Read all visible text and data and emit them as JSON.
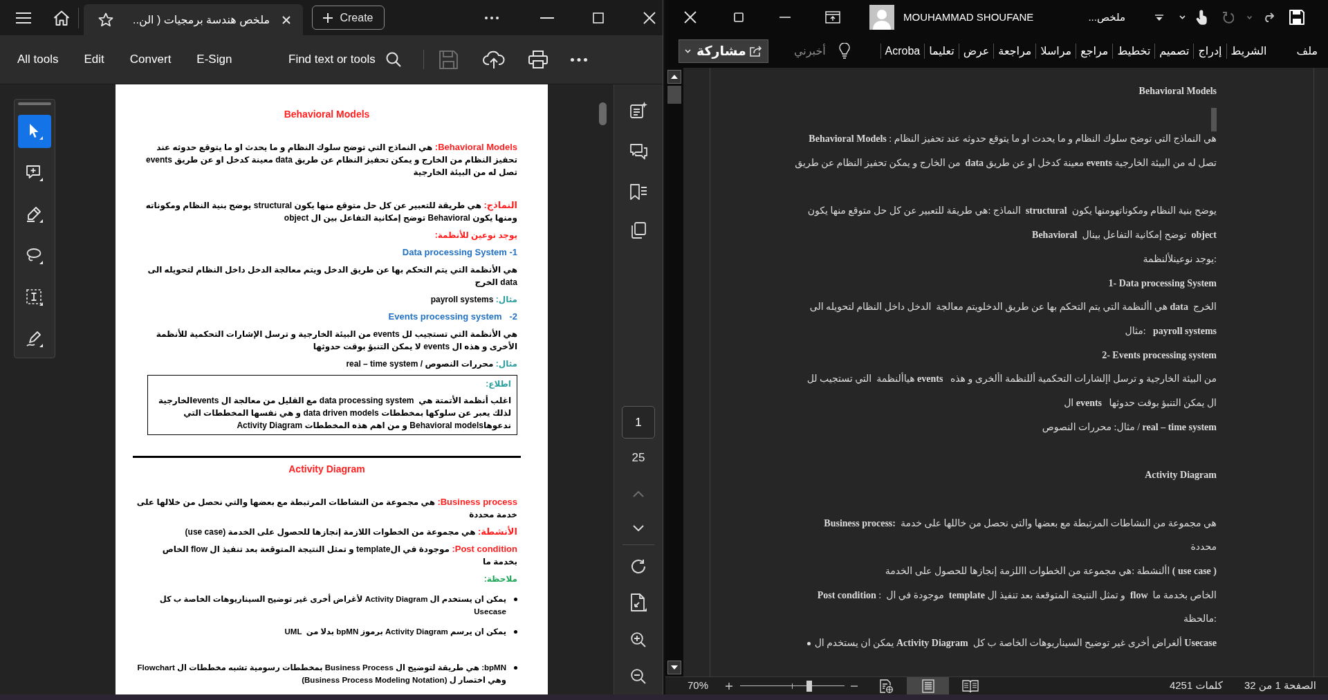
{
  "pdf_window": {
    "tab": {
      "title": "ملخص هندسة برمجيات ( الن.."
    },
    "create_button": "Create",
    "toolbar": {
      "all_tools": "All tools",
      "edit": "Edit",
      "convert": "Convert",
      "e_sign": "E-Sign",
      "find": "Find text or tools",
      "save": {
        "disabled": true
      }
    },
    "tools": [
      {
        "selected": true
      },
      {
        "selected": false
      },
      {
        "selected": false
      },
      {
        "selected": false
      },
      {
        "selected": false
      },
      {
        "selected": false
      }
    ],
    "page": {
      "groups": [
        [
          {
            "kind": "title",
            "text": "Behavioral Models"
          }
        ],
        [
          {
            "kind": "term",
            "label": "Behavioral Models:",
            "text": "هي النماذج التي توضح سلوك النظام و ما يحدث او ما يتوقع حدوثه عند تحفيز النظام من الخارج و يمكن تحفيز النظام عن طريق data معينة كدخل او عن طريق events تصل له من البيئة الخارجية"
          }
        ],
        [
          {
            "kind": "term",
            "label": "النماذج:",
            "text": "هي طريقة للتعبير عن كل حل متوقع منها يكون structural يوضح بنية النظام ومكوناته ومنها يكون Behavioral توضح إمكانية التفاعل بين ال object"
          },
          {
            "kind": "section",
            "text": "يوجد نوعين للأنظمة:"
          },
          {
            "kind": "numbered",
            "text": "1- Data processing System"
          },
          {
            "kind": "body",
            "text": "هي الأنظمة التي يتم التحكم بها عن طريق الدخل ويتم معالجة الدخل داخل النظام لتحويله الى data الخرج"
          },
          {
            "kind": "example",
            "label": "مثال:",
            "text": "payroll systems"
          },
          {
            "kind": "numbered",
            "text": "2-   Events processing system"
          },
          {
            "kind": "body",
            "text": "هي الأنظمة التي تستجيب لل events من البيئة الخارجية و ترسل الإشارات التحكمية للأنظمة الأخرى و هذه ال events لا يمكن التنبؤ بوقت حدوثها"
          },
          {
            "kind": "example",
            "label": "مثال:",
            "text": "محررات النصوص / real – time system"
          },
          {
            "kind": "box",
            "label": "اطلاع:",
            "text": "اغلب أنظمة الأتمتة هي  data processing system مع القليل من معالجة ال eventsالخارجية لذلك يعبر عن سلوكها بمخططات data driven models و هي نفسها المخططات التي ندعوهاBehavioral models و من اهم هذه المخططات Activity Diagram"
          }
        ],
        [
          {
            "kind": "rule"
          },
          {
            "kind": "title",
            "text": "Activity Diagram"
          }
        ],
        [
          {
            "kind": "term",
            "label": "Business process:",
            "text": "هي مجموعة من النشاطات المرتبطة مع بعضها والتي نحصل من خلالها على خدمة محددة"
          },
          {
            "kind": "term",
            "label": "الأنشطة:",
            "text": "هي مجموعة من الخطوات اللازمة إنجازها للحصول على الخدمة (use case)"
          },
          {
            "kind": "term",
            "label": "Post condition:",
            "text": "موجودة في الtemplate و تمثل النتيجة المتوقعة بعد تنفيذ ال flow الخاص بخدمة ما"
          },
          {
            "kind": "note",
            "text": "ملاحظة:"
          },
          {
            "kind": "bullet",
            "text": "يمكن ان يستخدم ال Activity Diagram لأغراض أخرى غير توضيح السيناريوهات الخاصة ب كل Usecase"
          },
          {
            "kind": "bullet",
            "text": "يمكن ان يرسم Activity Diagram برموز bpMN بدلا من  UML"
          }
        ],
        [
          {
            "kind": "bullet",
            "text": "bpMN: هي طريقة لتوضيح ال Business Process بمخططات رسومية تشبه مخططات ال Flowchart وهي اختصار ل (Business Process Modeling Notation)"
          }
        ]
      ]
    },
    "page_nav": {
      "current": "1",
      "total": "25",
      "previous": {
        "disabled": true
      }
    }
  },
  "word_window": {
    "user": "MOUHAMMAD SHOUFANE",
    "title": "ملخص...",
    "quick_access": [
      {
        "kind": "save",
        "disabled": false
      },
      {
        "kind": "redo",
        "disabled": false
      },
      {
        "kind": "undo",
        "disabled": true
      }
    ],
    "ribbon_tabs": [
      "ملف",
      "الشريط",
      "إدراج",
      "تصميم",
      "تخطيط",
      "مراجع",
      "مراسلا",
      "مراجعة",
      "عرض",
      "تعليما",
      "Acroba"
    ],
    "tell_me": "أخبرني",
    "share_button": "مشاركة",
    "document": {
      "blocks": [
        [
          {
            "kind": "heading",
            "text": "Behavioral Models"
          }
        ],
        [
          {
            "kind": "line",
            "text": "**Behavioral Models** : هي النماذج التي توضح سلوك النظام و ما يحدث او ما يتوقع حدوثه عند تحفيز النظام"
          },
          {
            "kind": "line",
            "text": "من الخارج و يمكن تحفيز النظام عن طريق  **data** معينة كدخل او عن طريق **events** تصل له من البيئة الخارجية"
          }
        ],
        [
          {
            "kind": "line",
            "text": "النماذج :هي طريقة للتعبير عن كل حل متوقع منها يكون  **structural**  يوضح بنية النظام ومكوناتهومنها يكون"
          },
          {
            "kind": "line",
            "text": "**Behavioral**  توضح إمكانية التفاعل بينال  **object**"
          },
          {
            "kind": "line",
            "text": "يوجد نوعينلألنظمة:"
          },
          {
            "kind": "heading",
            "text": "1- Data processing System"
          },
          {
            "kind": "line",
            "text": "هي األنظمة التي يتم التحكم بها عن طريق الدخلويتم معالجة  الدخل داخل النظام لتحويله الى **data**  الخرج"
          },
          {
            "kind": "line",
            "text": "مثال:   **payroll systems**"
          },
          {
            "kind": "heading",
            "text": "2- Events processing system"
          },
          {
            "kind": "line",
            "text": "هياألنظمة  التي تستجيب لل **events**   من البيئة الخارجية و ترسل اإلشارات التحكمية أللنظمة األخرى و هذه"
          },
          {
            "kind": "line",
            "text": "ال **events**   ال يمكن التنبؤ بوقت حدوثها"
          },
          {
            "kind": "line",
            "text": "مثال: محررات النصوص / **real – time system**"
          }
        ],
        [
          {
            "kind": "heading",
            "text": "Activity Diagram"
          }
        ],
        [
          {
            "kind": "line",
            "text": "**Business process:**  هي مجموعة من النشاطات المرتبطة مع بعضها والتي نحصل من خاللها على خدمة"
          },
          {
            "kind": "line",
            "text": "محددة"
          },
          {
            "kind": "line",
            "text": "األنشطة :هي مجموعة من الخطوات االلزمة إنجازها للحصول على الخدمة **( use case )**"
          },
          {
            "kind": "line",
            "text": "**Post condition** :  موجودة في ال  **template** و تمثل النتيجة المتوقعة بعد تنفيذ ال  **flow**  الخاص بخدمة ما"
          },
          {
            "kind": "line",
            "text": "مالحظة:"
          },
          {
            "kind": "bullet",
            "text": "يمكن ان يستخدم ال **Activity Diagram**  ألغراض أخرى غير توضيح السيناريوهات الخاصة ب كل **Usecase**"
          }
        ]
      ]
    },
    "status_bar": {
      "page": "الصفحة 1 من 32",
      "words": "4251 كلمات",
      "views": [
        {
          "selected": false
        },
        {
          "selected": true
        },
        {
          "selected": false
        }
      ],
      "zoom": {
        "reading": "70%",
        "level": 0.66
      }
    }
  }
}
